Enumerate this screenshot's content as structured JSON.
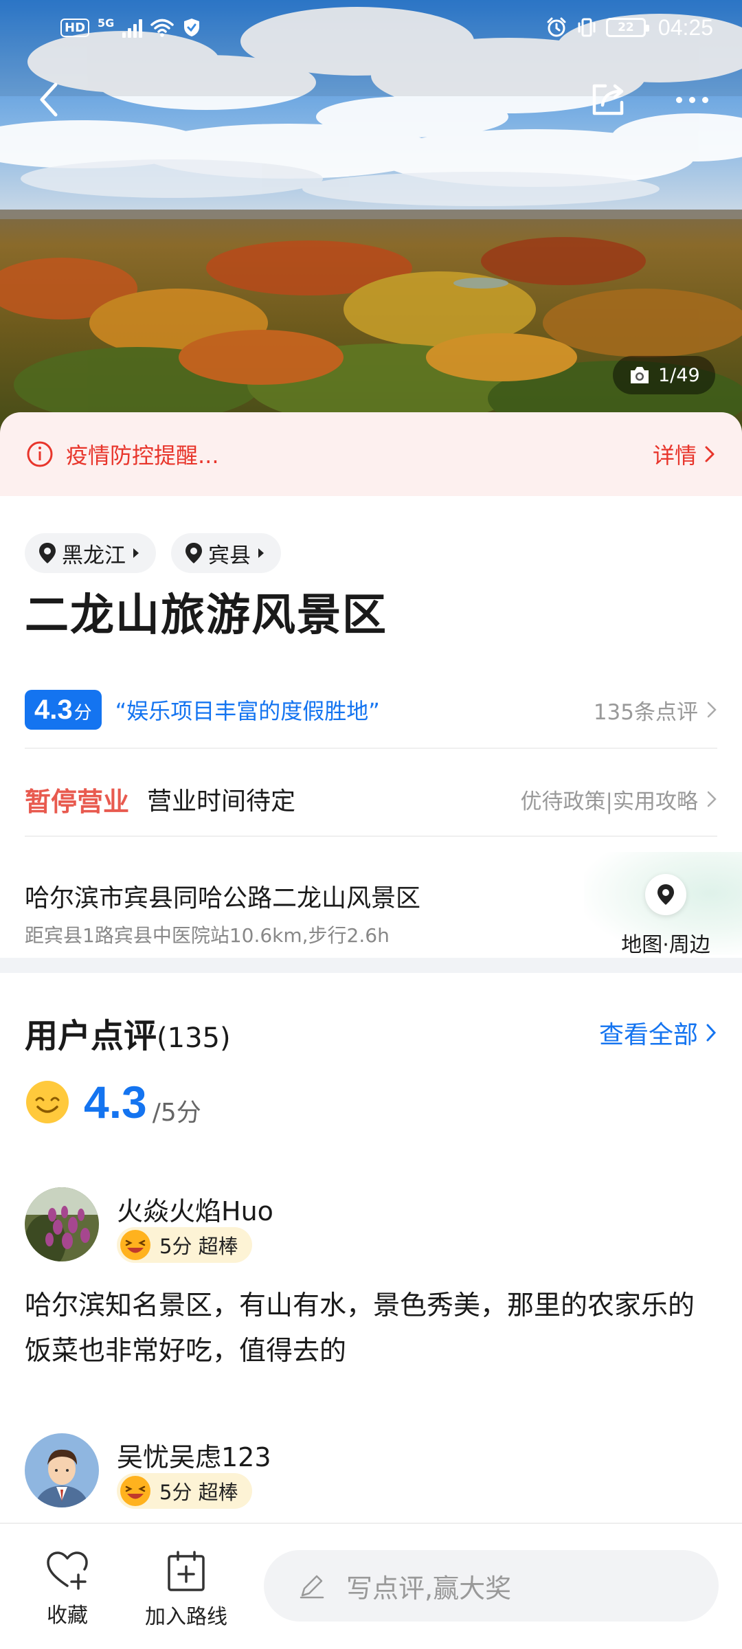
{
  "status_bar": {
    "hd": "HD",
    "network": "5G",
    "battery": "22",
    "time": "04:25"
  },
  "hero": {
    "photo_counter": "1/49"
  },
  "alert": {
    "text": "疫情防控提醒...",
    "detail_label": "详情"
  },
  "poi": {
    "province": "黑龙江",
    "county": "宾县",
    "name": "二龙山旅游风景区",
    "rating": "4.3",
    "rating_unit": "分",
    "tagline": "“娱乐项目丰富的度假胜地”",
    "review_link": "135条点评",
    "status": "暂停营业",
    "hours": "营业时间待定",
    "policy_link": "优待政策|实用攻略",
    "address": "哈尔滨市宾县同哈公路二龙山风景区",
    "distance": "距宾县1路宾县中医院站10.6km,步行2.6h",
    "map_label": "地图·周边"
  },
  "reviews": {
    "title": "用户点评",
    "count": "(135)",
    "see_all": "查看全部",
    "score": "4.3",
    "score_max": "/5分",
    "items": [
      {
        "user": "火焱火焰Huo",
        "badge": "5分 超棒",
        "text": "哈尔滨知名景区，有山有水，景色秀美，那里的农家乐的饭菜也非常好吃，值得去的"
      },
      {
        "user": "吴忧吴虑123",
        "badge": "5分 超棒"
      }
    ]
  },
  "bottom_bar": {
    "favorite": "收藏",
    "add_route": "加入路线",
    "write_review_placeholder": "写点评,赢大奖"
  },
  "colors": {
    "accent": "#1474f0",
    "alert_red": "#e8352b",
    "closed_red": "#e85a4f",
    "badge_bg": "#fdf3d5"
  }
}
